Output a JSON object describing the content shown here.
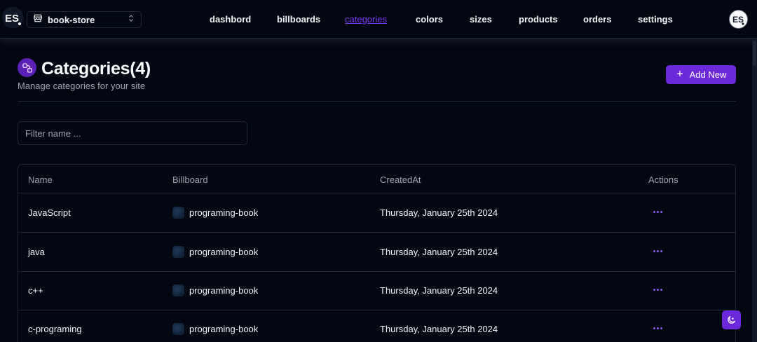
{
  "store_switcher": {
    "label": "book-store"
  },
  "nav": {
    "items": [
      {
        "label": "dashbord",
        "active": false
      },
      {
        "label": "billboards",
        "active": false
      },
      {
        "label": "categories",
        "active": true
      },
      {
        "label": "colors",
        "active": false
      },
      {
        "label": "sizes",
        "active": false
      },
      {
        "label": "products",
        "active": false
      },
      {
        "label": "orders",
        "active": false
      },
      {
        "label": "settings",
        "active": false
      }
    ]
  },
  "header": {
    "title": "Categories(4)",
    "subtitle": "Manage categories for your site",
    "add_label": "Add New",
    "icon": "categories-icon"
  },
  "filter": {
    "placeholder": "Filter name ...",
    "value": ""
  },
  "table": {
    "columns": [
      "Name",
      "Billboard",
      "CreatedAt",
      "Actions"
    ],
    "rows": [
      {
        "name": "JavaScript",
        "billboard": "programing-book",
        "created_at": "Thursday, January 25th 2024"
      },
      {
        "name": "java",
        "billboard": "programing-book",
        "created_at": "Thursday, January 25th 2024"
      },
      {
        "name": "c++",
        "billboard": "programing-book",
        "created_at": "Thursday, January 25th 2024"
      },
      {
        "name": "c-programing",
        "billboard": "programing-book",
        "created_at": "Thursday, January 25th 2024"
      }
    ]
  },
  "colors": {
    "accent": "#6d28d9",
    "background": "#030712",
    "border": "#1f2937"
  },
  "icons": [
    "store-icon",
    "chevrons-up-down-icon",
    "plus-icon",
    "more-horizontal-icon",
    "theme-toggle-icon"
  ]
}
